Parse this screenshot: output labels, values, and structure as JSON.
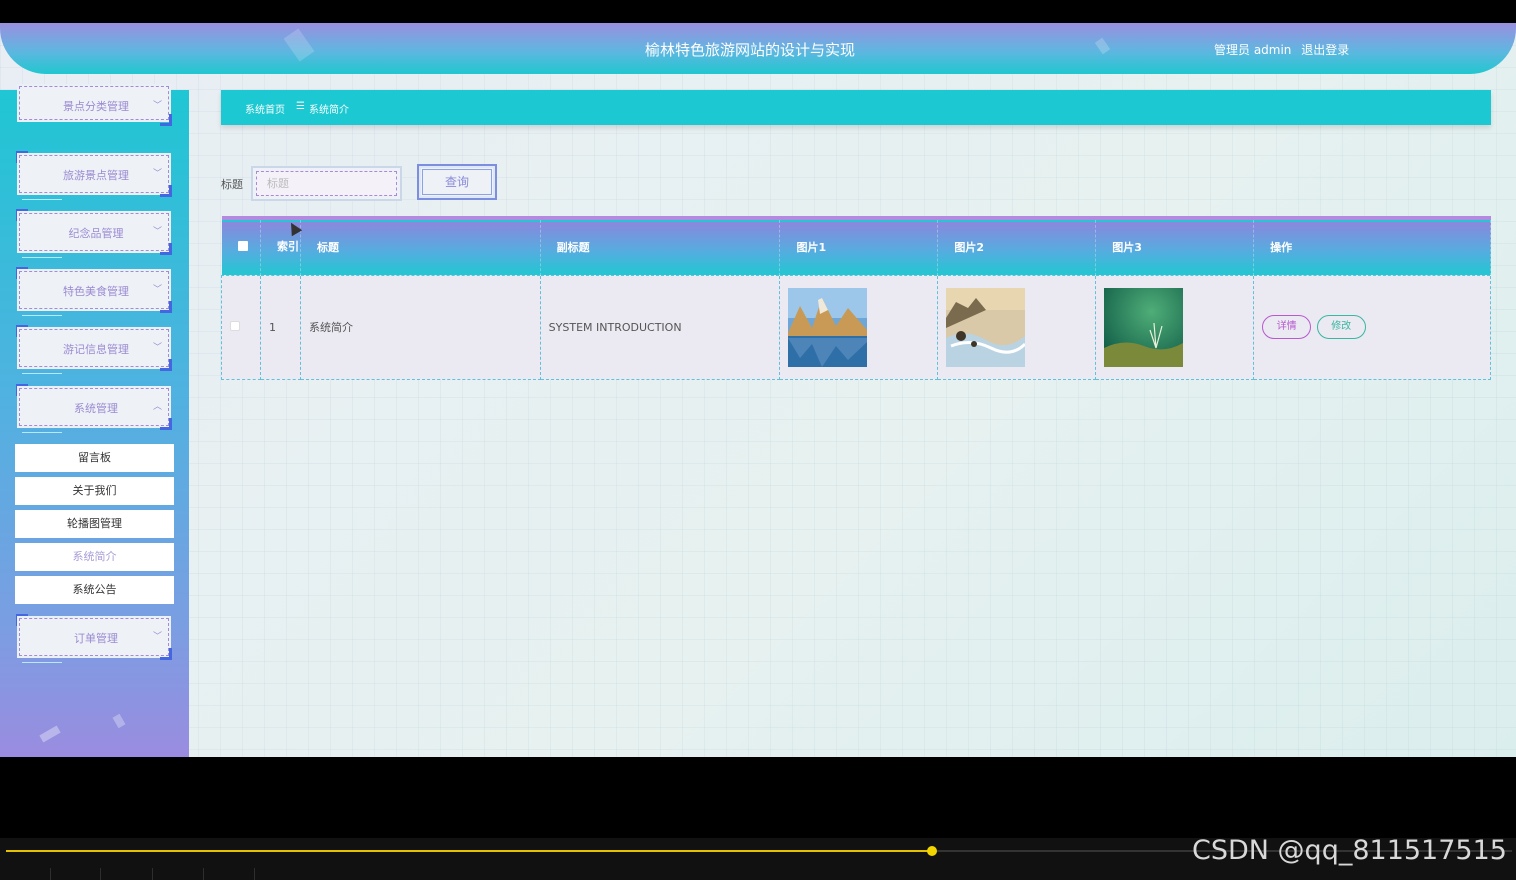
{
  "header": {
    "title": "榆林特色旅游网站的设计与实现",
    "user_label": "管理员 admin",
    "logout_label": "退出登录"
  },
  "sidebar": {
    "menus": [
      {
        "label": "景点分类管理"
      },
      {
        "label": "旅游景点管理"
      },
      {
        "label": "纪念品管理"
      },
      {
        "label": "特色美食管理"
      },
      {
        "label": "游记信息管理"
      },
      {
        "label": "系统管理"
      },
      {
        "label": "订单管理"
      }
    ],
    "submenu": [
      {
        "label": "留言板"
      },
      {
        "label": "关于我们"
      },
      {
        "label": "轮播图管理"
      },
      {
        "label": "系统简介"
      },
      {
        "label": "系统公告"
      }
    ]
  },
  "breadcrumb": {
    "home": "系统首页",
    "separator": "☰",
    "current": "系统简介"
  },
  "search": {
    "label": "标题",
    "placeholder": "标题",
    "button_label": "查询"
  },
  "table": {
    "columns": [
      "索引",
      "标题",
      "副标题",
      "图片1",
      "图片2",
      "图片3",
      "操作"
    ],
    "rows": [
      {
        "index": "1",
        "title": "系统简介",
        "subtitle": "SYSTEM INTRODUCTION",
        "detail_label": "详情",
        "edit_label": "修改"
      }
    ]
  },
  "player": {
    "watermark": "CSDN @qq_811517515",
    "progress_fraction": 0.615
  },
  "colors": {
    "accent_cyan": "#1cc8d1",
    "accent_purple": "#9a8fe0",
    "detail": "#b65ad0",
    "edit": "#38b7a2"
  }
}
